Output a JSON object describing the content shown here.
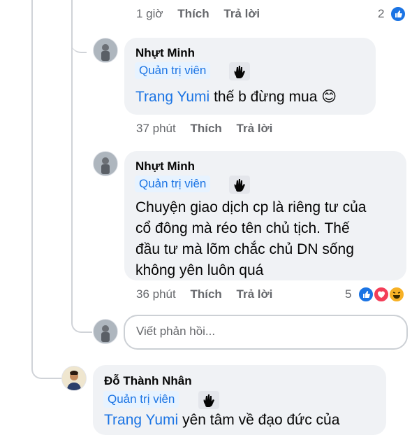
{
  "top_comment": {
    "time": "1 giờ",
    "like": "Thích",
    "reply": "Trả lời",
    "reaction_count": "2",
    "reactions": [
      "like"
    ]
  },
  "replies": [
    {
      "author": "Nhựt Minh",
      "badge": "Quản trị viên",
      "mention": "Trang Yumi",
      "text": " thế b đừng mua 😊",
      "time": "37 phút",
      "like": "Thích",
      "reply": "Trả lời"
    },
    {
      "author": "Nhựt Minh",
      "badge": "Quản trị viên",
      "text_lines": [
        "Chuyện giao dịch cp là riêng tư của",
        "cổ đông mà réo tên chủ tịch. Thế",
        "đầu tư mà lõm chắc chủ DN sống",
        "không yên luôn quá"
      ],
      "time": "36 phút",
      "like": "Thích",
      "reply": "Trả lời",
      "reaction_count": "5",
      "reactions": [
        "like",
        "love",
        "haha"
      ]
    }
  ],
  "reply_box": {
    "placeholder": "Viết phản hồi..."
  },
  "next_comment": {
    "author": "Đỗ Thành Nhân",
    "badge": "Quản trị viên",
    "mention": "Trang Yumi",
    "text": " yên tâm về đạo đức của"
  },
  "colors": {
    "accent": "#1b74e4",
    "bubble": "#f0f2f5",
    "muted": "#65676b",
    "love": "#f33e58",
    "haha": "#f7b125"
  }
}
